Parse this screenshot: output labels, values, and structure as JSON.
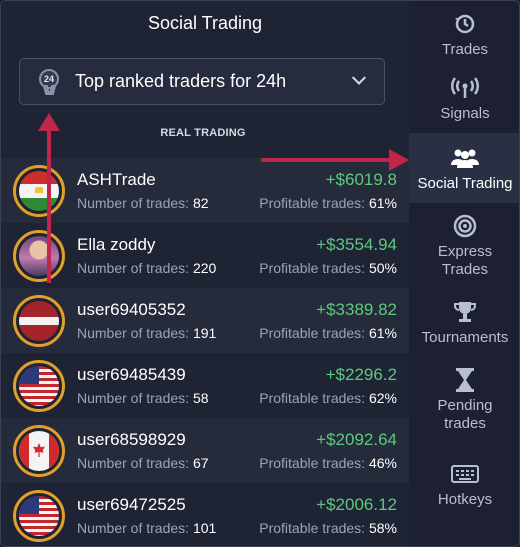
{
  "panel": {
    "title": "Social Trading",
    "dropdown": {
      "badge": "24",
      "label": "Top ranked traders for 24h"
    },
    "section_label": "REAL TRADING"
  },
  "traders": [
    {
      "name": "ASHTrade",
      "profit": "+$6019.8",
      "trades_label": "Number of trades:",
      "trades": "82",
      "profitable_label": "Profitable trades:",
      "profitable": "61%",
      "avatar": "flag-tajikistan"
    },
    {
      "name": "Ella zoddy",
      "profit": "+$3554.94",
      "trades_label": "Number of trades:",
      "trades": "220",
      "profitable_label": "Profitable trades:",
      "profitable": "50%",
      "avatar": "user-photo"
    },
    {
      "name": "user69405352",
      "profit": "+$3389.82",
      "trades_label": "Number of trades:",
      "trades": "191",
      "profitable_label": "Profitable trades:",
      "profitable": "61%",
      "avatar": "flag-latvia"
    },
    {
      "name": "user69485439",
      "profit": "+$2296.2",
      "trades_label": "Number of trades:",
      "trades": "58",
      "profitable_label": "Profitable trades:",
      "profitable": "62%",
      "avatar": "flag-usa"
    },
    {
      "name": "user68598929",
      "profit": "+$2092.64",
      "trades_label": "Number of trades:",
      "trades": "67",
      "profitable_label": "Profitable trades:",
      "profitable": "46%",
      "avatar": "flag-canada"
    },
    {
      "name": "user69472525",
      "profit": "+$2006.12",
      "trades_label": "Number of trades:",
      "trades": "101",
      "profitable_label": "Profitable trades:",
      "profitable": "58%",
      "avatar": "flag-usa"
    }
  ],
  "sidebar": {
    "items": [
      {
        "label": "Trades",
        "icon": "history-icon"
      },
      {
        "label": "Signals",
        "icon": "signal-icon"
      },
      {
        "label": "Social Trading",
        "icon": "users-icon",
        "active": true
      },
      {
        "label": "Express Trades",
        "icon": "target-icon"
      },
      {
        "label": "Tournaments",
        "icon": "trophy-icon"
      },
      {
        "label": "Pending trades",
        "icon": "hourglass-icon"
      },
      {
        "label": "Hotkeys",
        "icon": "keyboard-icon"
      }
    ]
  },
  "colors": {
    "profit": "#5cc97e",
    "accent_ring": "#e0a02a",
    "annotation": "#c2254a",
    "background": "#1f2435"
  }
}
